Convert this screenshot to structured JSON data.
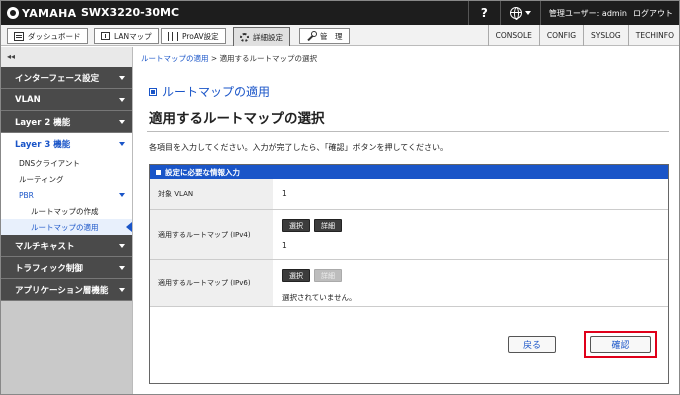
{
  "header": {
    "brand": "YAMAHA",
    "model": "SWX3220-30MC",
    "help": "?",
    "user": "管理ユーザー: admin",
    "logout": "ログアウト"
  },
  "tabs": [
    {
      "label": "ダッシュボード",
      "icon": "dashboard-icon"
    },
    {
      "label": "LANマップ",
      "icon": "lan-map-icon"
    },
    {
      "label": "ProAV設定",
      "icon": "proav-icon"
    },
    {
      "label": "詳細設定",
      "icon": "gear-icon"
    },
    {
      "label": "管　理",
      "icon": "tool-icon"
    }
  ],
  "toplinks": [
    "CONSOLE",
    "CONFIG",
    "SYSLOG",
    "TECHINFO"
  ],
  "sidebar": {
    "collapse": "◂◂",
    "items": [
      {
        "label": "インターフェース設定"
      },
      {
        "label": "VLAN"
      },
      {
        "label": "Layer 2 機能"
      },
      {
        "label": "Layer 3 機能"
      },
      {
        "label": "マルチキャスト"
      },
      {
        "label": "トラフィック制御"
      },
      {
        "label": "アプリケーション層機能"
      }
    ],
    "sub": [
      "DNSクライアント",
      "ルーティング",
      "PBR"
    ],
    "sub2": [
      "ルートマップの作成",
      "ルートマップの適用"
    ]
  },
  "main": {
    "breadcrumb_link": "ルートマップの適用",
    "breadcrumb_sep": " > ",
    "breadcrumb_current": "適用するルートマップの選択",
    "page_title": "ルートマップの適用",
    "section_title": "適用するルートマップの選択",
    "instruction": "各項目を入力してください。入力が完了したら、「確認」ボタンを押してください。",
    "panel_title": "設定に必要な情報入力",
    "rows": {
      "vlan_label": "対象 VLAN",
      "vlan_value": "1",
      "ipv4_label": "適用するルートマップ (IPv4)",
      "ipv4_value": "1",
      "ipv6_label": "適用するルートマップ (IPv6)",
      "ipv6_value": "選択されていません。"
    },
    "select_label": "選択",
    "detail_label": "詳細",
    "back_label": "戻る",
    "confirm_label": "確認"
  }
}
